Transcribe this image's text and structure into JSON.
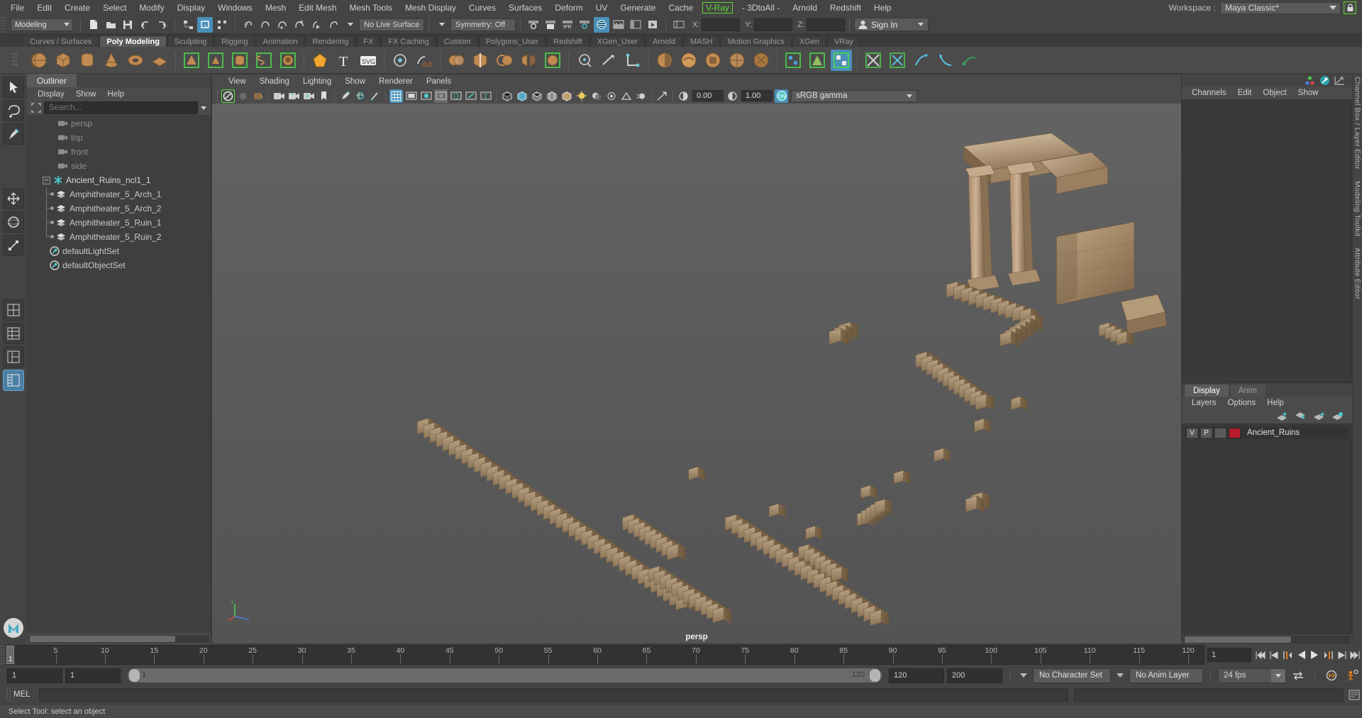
{
  "menubar": {
    "items": [
      "File",
      "Edit",
      "Create",
      "Select",
      "Modify",
      "Display",
      "Windows",
      "Mesh",
      "Edit Mesh",
      "Mesh Tools",
      "Mesh Display",
      "Curves",
      "Surfaces",
      "Deform",
      "UV",
      "Generate",
      "Cache"
    ],
    "vray": "V-Ray",
    "items_after": [
      "- 3DtoAll -",
      "Arnold",
      "Redshift",
      "Help"
    ],
    "workspace_label": "Workspace :",
    "workspace_value": "Maya Classic*",
    "lock_icon": "lock-icon",
    "vray_color": "#5dd835"
  },
  "statusline": {
    "mode": "Modeling",
    "no_live_surface": "No Live Surface",
    "symmetry": "Symmetry: Off",
    "coord_x_label": "X:",
    "coord_y_label": "Y:",
    "coord_z_label": "Z:",
    "coord_x": "",
    "coord_y": "",
    "coord_z": "",
    "signin": "Sign In",
    "signin_icon": "user-icon"
  },
  "shelf": {
    "tabs": [
      "Curves / Surfaces",
      "Poly Modeling",
      "Sculpting",
      "Rigging",
      "Animation",
      "Rendering",
      "FX",
      "FX Caching",
      "Custom",
      "Polygons_User",
      "Redshift",
      "XGen_User",
      "Arnold",
      "MASH",
      "Motion Graphics",
      "XGen",
      "VRay"
    ],
    "active_tab": "Poly Modeling"
  },
  "toolbox": {
    "items": [
      {
        "name": "select-tool",
        "selected": false
      },
      {
        "name": "lasso-tool",
        "selected": false
      },
      {
        "name": "paint-select-tool",
        "selected": false
      },
      {
        "name": "move-tool",
        "selected": false
      },
      {
        "name": "rotate-tool",
        "selected": false
      },
      {
        "name": "scale-tool",
        "selected": false
      },
      {
        "name": "last-tool",
        "selected": false
      },
      {
        "name": "four-view-layout",
        "selected": false
      },
      {
        "name": "persp-outliner-layout",
        "selected": false
      },
      {
        "name": "persp-graph-layout",
        "selected": false
      },
      {
        "name": "outliner-persp-layout",
        "selected": true
      }
    ],
    "logo": "maya-logo"
  },
  "outliner": {
    "title": "Outliner",
    "menu": [
      "Display",
      "Show",
      "Help"
    ],
    "search_placeholder": "Search...",
    "search_value": "",
    "tree": [
      {
        "label": "persp",
        "icon": "camera-icon",
        "depth": 1,
        "dim": true
      },
      {
        "label": "top",
        "icon": "camera-icon",
        "depth": 1,
        "dim": true
      },
      {
        "label": "front",
        "icon": "camera-icon",
        "depth": 1,
        "dim": true
      },
      {
        "label": "side",
        "icon": "camera-icon",
        "depth": 1,
        "dim": true
      },
      {
        "label": "Ancient_Ruins_ncl1_1",
        "icon": "nucleus-icon",
        "depth": 0,
        "dim": false,
        "expanded": true
      },
      {
        "label": "Amphitheater_5_Arch_1",
        "icon": "mesh-icon",
        "depth": 1,
        "dim": false
      },
      {
        "label": "Amphitheater_5_Arch_2",
        "icon": "mesh-icon",
        "depth": 1,
        "dim": false
      },
      {
        "label": "Amphitheater_5_Ruin_1",
        "icon": "mesh-icon",
        "depth": 1,
        "dim": false
      },
      {
        "label": "Amphitheater_5_Ruin_2",
        "icon": "mesh-icon",
        "depth": 1,
        "dim": false
      },
      {
        "label": "defaultLightSet",
        "icon": "set-icon",
        "depth": 0,
        "dim": false
      },
      {
        "label": "defaultObjectSet",
        "icon": "set-icon",
        "depth": 0,
        "dim": false
      }
    ]
  },
  "viewport": {
    "menu": [
      "View",
      "Shading",
      "Lighting",
      "Show",
      "Renderer",
      "Panels"
    ],
    "exposure_value": "0.00",
    "gamma_value": "1.00",
    "color_space": "sRGB gamma",
    "camera_label": "persp",
    "gizmo": "axis-gizmo"
  },
  "channelbox": {
    "menu": [
      "Channels",
      "Edit",
      "Object",
      "Show"
    ],
    "rail_labels": [
      "Channel Box / Layer Editor",
      "Modeling Toolkit",
      "Attribute Editor"
    ]
  },
  "layereditor": {
    "tabs": [
      "Display",
      "Anim"
    ],
    "active_tab": "Display",
    "menu": [
      "Layers",
      "Options",
      "Help"
    ],
    "buttons": [
      "move-layer-up-icon",
      "move-layer-down-icon",
      "new-layer-from-selected-icon",
      "new-layer-icon"
    ],
    "layers": [
      {
        "visible": "V",
        "playback": "P",
        "shading": "",
        "color": "#b71c2c",
        "name": "Ancient_Ruins"
      }
    ]
  },
  "timeline": {
    "ticks": [
      5,
      10,
      15,
      20,
      25,
      30,
      35,
      40,
      45,
      50,
      55,
      60,
      65,
      70,
      75,
      80,
      85,
      90,
      95,
      100,
      105,
      110,
      115,
      120
    ],
    "start": 1,
    "end": 120,
    "current_frame": "1",
    "current_frame_field": "1",
    "playback_buttons": [
      "go-to-start-icon",
      "step-back-key-icon",
      "step-back-frame-icon",
      "play-backwards-icon",
      "play-forwards-icon",
      "step-forward-frame-icon",
      "step-forward-key-icon",
      "go-to-end-icon"
    ]
  },
  "rangeslider": {
    "anim_start": "1",
    "range_start": "1",
    "bar_start_label": "1",
    "bar_end_label": "120",
    "range_end": "120",
    "anim_end": "200",
    "character_set": "No Character Set",
    "anim_layer": "No Anim Layer",
    "fps": "24 fps",
    "loop_icon": "loop-icon",
    "auto_key_icon": "auto-keyframe-icon",
    "anim_prefs_icon": "animation-preferences-icon"
  },
  "commandline": {
    "label": "MEL",
    "input_value": "",
    "script_editor_icon": "script-editor-icon"
  },
  "helpline": {
    "text": "Select Tool: select an object"
  }
}
